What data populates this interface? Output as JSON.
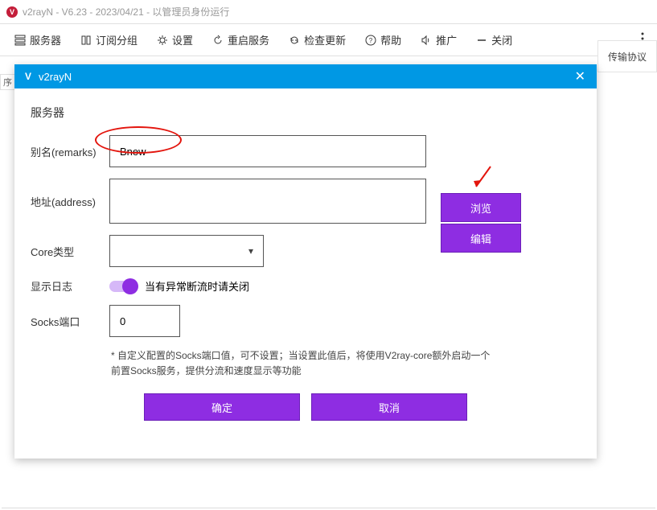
{
  "window": {
    "title": "v2rayN - V6.23 - 2023/04/21 - 以管理员身份运行"
  },
  "toolbar": {
    "servers": "服务器",
    "sub_group": "订阅分组",
    "settings": "设置",
    "restart_service": "重启服务",
    "check_update": "检查更新",
    "help": "帮助",
    "promo": "推广",
    "close": "关闭"
  },
  "bg": {
    "col_protocol": "传输协议",
    "left_stub": "序"
  },
  "dialog": {
    "title": "v2rayN",
    "section": "服务器",
    "labels": {
      "remarks": "别名(remarks)",
      "address": "地址(address)",
      "core_type": "Core类型",
      "show_log": "显示日志",
      "socks_port": "Socks端口"
    },
    "values": {
      "remarks": "Bnew",
      "address": "",
      "core_type": "",
      "socks_port": "0"
    },
    "toggle_hint": "当有异常断流时请关闭",
    "side_buttons": {
      "browse": "浏览",
      "edit": "编辑"
    },
    "help_text": "* 自定义配置的Socks端口值，可不设置；当设置此值后，将使用V2ray-core额外启动一个前置Socks服务，提供分流和速度显示等功能",
    "buttons": {
      "ok": "确定",
      "cancel": "取消"
    }
  }
}
